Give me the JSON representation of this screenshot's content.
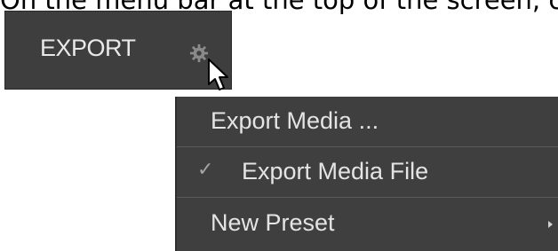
{
  "instruction_text": "On the menu bar at the top of the screen, click the",
  "menubar": {
    "export_label": "EXPORT",
    "gear_icon": "gear-icon",
    "cursor_icon": "cursor-icon"
  },
  "menu": {
    "items": [
      {
        "label": "Export Media ...",
        "checked": false,
        "has_submenu": false
      },
      {
        "label": "Export Media File",
        "checked": true,
        "has_submenu": false
      },
      {
        "label": "New Preset",
        "checked": false,
        "has_submenu": true
      }
    ],
    "check_glyph": "✓"
  },
  "colors": {
    "menu_bg": "#3f3f3f",
    "menu_text": "#e4e4e4",
    "button_bg": "#3e3e3e"
  }
}
